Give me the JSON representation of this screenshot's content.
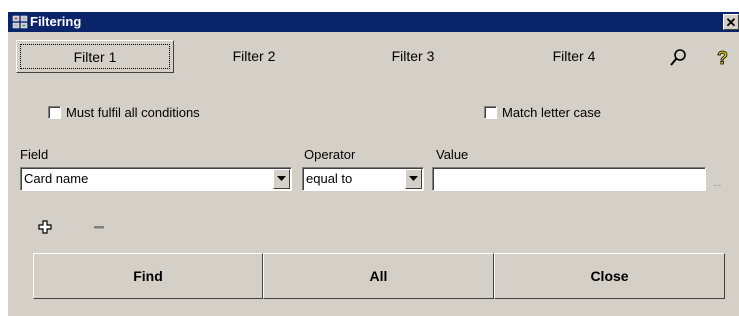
{
  "window": {
    "title": "Filtering",
    "close_label": "✕"
  },
  "tabs": [
    {
      "label": "Filter 1",
      "active": true
    },
    {
      "label": "Filter 2"
    },
    {
      "label": "Filter 3"
    },
    {
      "label": "Filter 4"
    }
  ],
  "toolbar": {
    "search_icon": "magnifier-icon",
    "help_icon": "question-mark-icon"
  },
  "options": {
    "must_fulfil_all": {
      "label": "Must fulfil all conditions",
      "checked": false
    },
    "match_case": {
      "label": "Match letter case",
      "checked": false
    }
  },
  "condition": {
    "field_label": "Field",
    "field_value": "Card name",
    "operator_label": "Operator",
    "operator_value": "equal to",
    "value_label": "Value",
    "value_value": "",
    "more_label": "..."
  },
  "buttons": {
    "find": "Find",
    "all": "All",
    "close": "Close"
  },
  "colors": {
    "titlebar": "#0a246a",
    "face": "#d4d0c8",
    "add_icon": "#000000",
    "remove_icon": "#808080"
  }
}
